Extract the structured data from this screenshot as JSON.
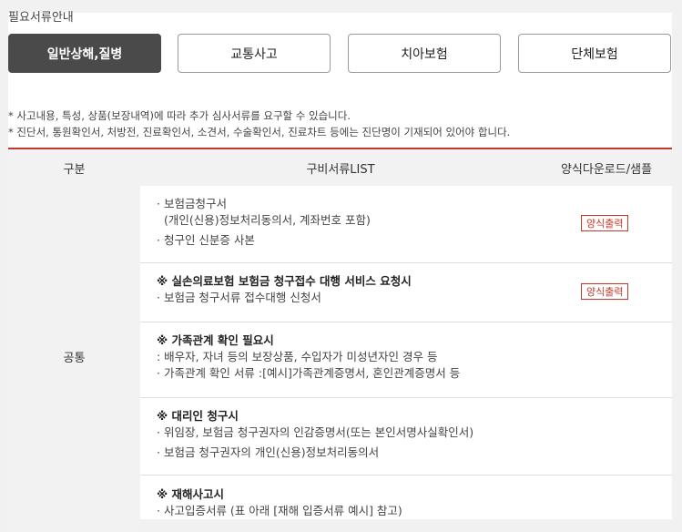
{
  "page_title": "필요서류안내",
  "tabs": [
    {
      "label": "일반상해,질병",
      "active": true
    },
    {
      "label": "교통사고",
      "active": false
    },
    {
      "label": "치아보험",
      "active": false
    },
    {
      "label": "단체보험",
      "active": false
    }
  ],
  "notes": [
    "* 사고내용, 특성, 상품(보장내역)에 따라 추가 심사서류를 요구할 수 있습니다.",
    "* 진단서, 통원확인서, 처방전, 진료확인서, 소견서, 수술확인서, 진료차트 등에는 진단명이 기재되어 있어야 합니다."
  ],
  "table": {
    "headers": [
      "구분",
      "구비서류LIST",
      "양식다운로드/샘플"
    ],
    "category": "공통",
    "rows": [
      {
        "lines": [
          "· 보험금청구서",
          "  (개인(신용)정보처리동의서, 계좌번호 포함)",
          "· 청구인 신분증 사본"
        ],
        "form_button": "양식출력"
      },
      {
        "title": "※ 실손의료보험 보험금 청구접수 대행 서비스 요청시",
        "lines": [
          "· 보험금 청구서류 접수대행 신청서"
        ],
        "form_button": "양식출력"
      },
      {
        "title": "※ 가족관계 확인 필요시",
        "lines": [
          ": 배우자, 자녀 등의 보장상품, 수입자가 미성년자인 경우 등",
          "· 가족관계 확인 서류 :[예시]가족관계증명서, 혼인관계증명서 등"
        ]
      },
      {
        "title": "※ 대리인 청구시",
        "lines": [
          "· 위임장, 보험금 청구권자의 인감증명서(또는 본인서명사실확인서)",
          "· 보험금 청구권자의 개인(신용)정보처리동의서"
        ]
      },
      {
        "title": "※ 재해사고시",
        "lines": [
          "· 사고입증서류 (표 아래 [재해 입증서류 예시] 참고)"
        ]
      }
    ]
  }
}
